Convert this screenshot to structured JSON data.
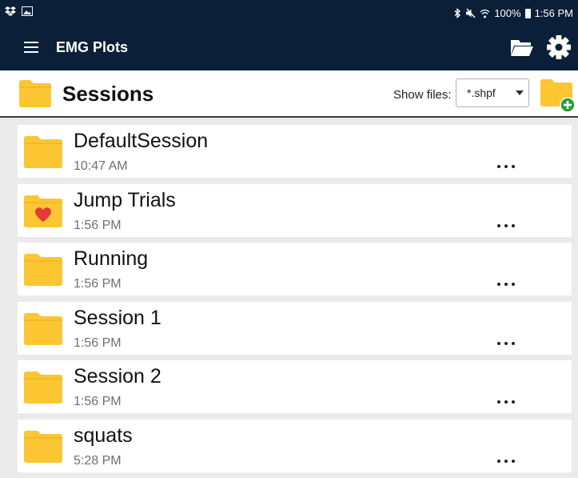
{
  "status_bar": {
    "time": "1:56 PM",
    "battery": "100%",
    "icons": [
      "dropbox-icon",
      "image-icon",
      "bluetooth-icon",
      "mute-icon",
      "wifi-icon",
      "battery-icon"
    ]
  },
  "toolbar": {
    "title": "EMG Plots",
    "background": "#0c1f38"
  },
  "header": {
    "title": "Sessions",
    "show_files_label": "Show files:",
    "filter_value": "*.shpf"
  },
  "colors": {
    "folder": "#fcc633",
    "heart": "#e53935",
    "add": "#2e9d3a"
  },
  "sessions": [
    {
      "name": "DefaultSession",
      "time": "10:47 AM",
      "icon": "folder-icon"
    },
    {
      "name": "Jump Trials",
      "time": "1:56 PM",
      "icon": "heart-folder-icon"
    },
    {
      "name": "Running",
      "time": "1:56 PM",
      "icon": "folder-icon"
    },
    {
      "name": "Session 1",
      "time": "1:56 PM",
      "icon": "folder-icon"
    },
    {
      "name": "Session 2",
      "time": "1:56 PM",
      "icon": "folder-icon"
    },
    {
      "name": "squats",
      "time": "5:28 PM",
      "icon": "folder-icon"
    }
  ]
}
